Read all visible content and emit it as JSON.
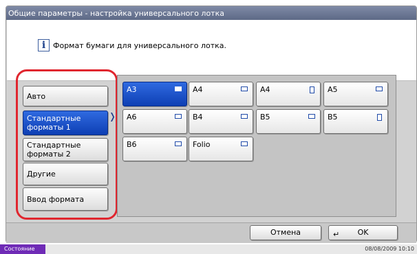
{
  "window": {
    "title": "Общие параметры - настройка универсального лотка"
  },
  "message": {
    "icon": "info-icon",
    "text": "Формат бумаги для универсального лотка."
  },
  "size_categories": [
    {
      "label": "Авто",
      "selected": false
    },
    {
      "label": "Стандартные форматы 1",
      "selected": true
    },
    {
      "label": "Стандартные форматы 2",
      "selected": false
    },
    {
      "label": "Другие",
      "selected": false
    },
    {
      "label": "Ввод формата",
      "selected": false
    }
  ],
  "paper_sizes": [
    {
      "label": "A3",
      "orientation": "landscape",
      "selected": true
    },
    {
      "label": "A4",
      "orientation": "landscape",
      "selected": false
    },
    {
      "label": "A4",
      "orientation": "portrait",
      "selected": false
    },
    {
      "label": "A5",
      "orientation": "landscape",
      "selected": false
    },
    {
      "label": "A6",
      "orientation": "landscape",
      "selected": false
    },
    {
      "label": "B4",
      "orientation": "landscape",
      "selected": false
    },
    {
      "label": "B5",
      "orientation": "landscape",
      "selected": false
    },
    {
      "label": "B5",
      "orientation": "portrait",
      "selected": false
    },
    {
      "label": "B6",
      "orientation": "landscape",
      "selected": false
    },
    {
      "label": "Folio",
      "orientation": "landscape",
      "selected": false
    }
  ],
  "buttons": {
    "cancel": "Отмена",
    "ok": "OK"
  },
  "status": {
    "label": "Состояние",
    "datetime": "08/08/2009   10:10"
  },
  "colors": {
    "accent": "#0e3fb4",
    "highlight": "#e0262f",
    "status": "#6f2bb6"
  }
}
